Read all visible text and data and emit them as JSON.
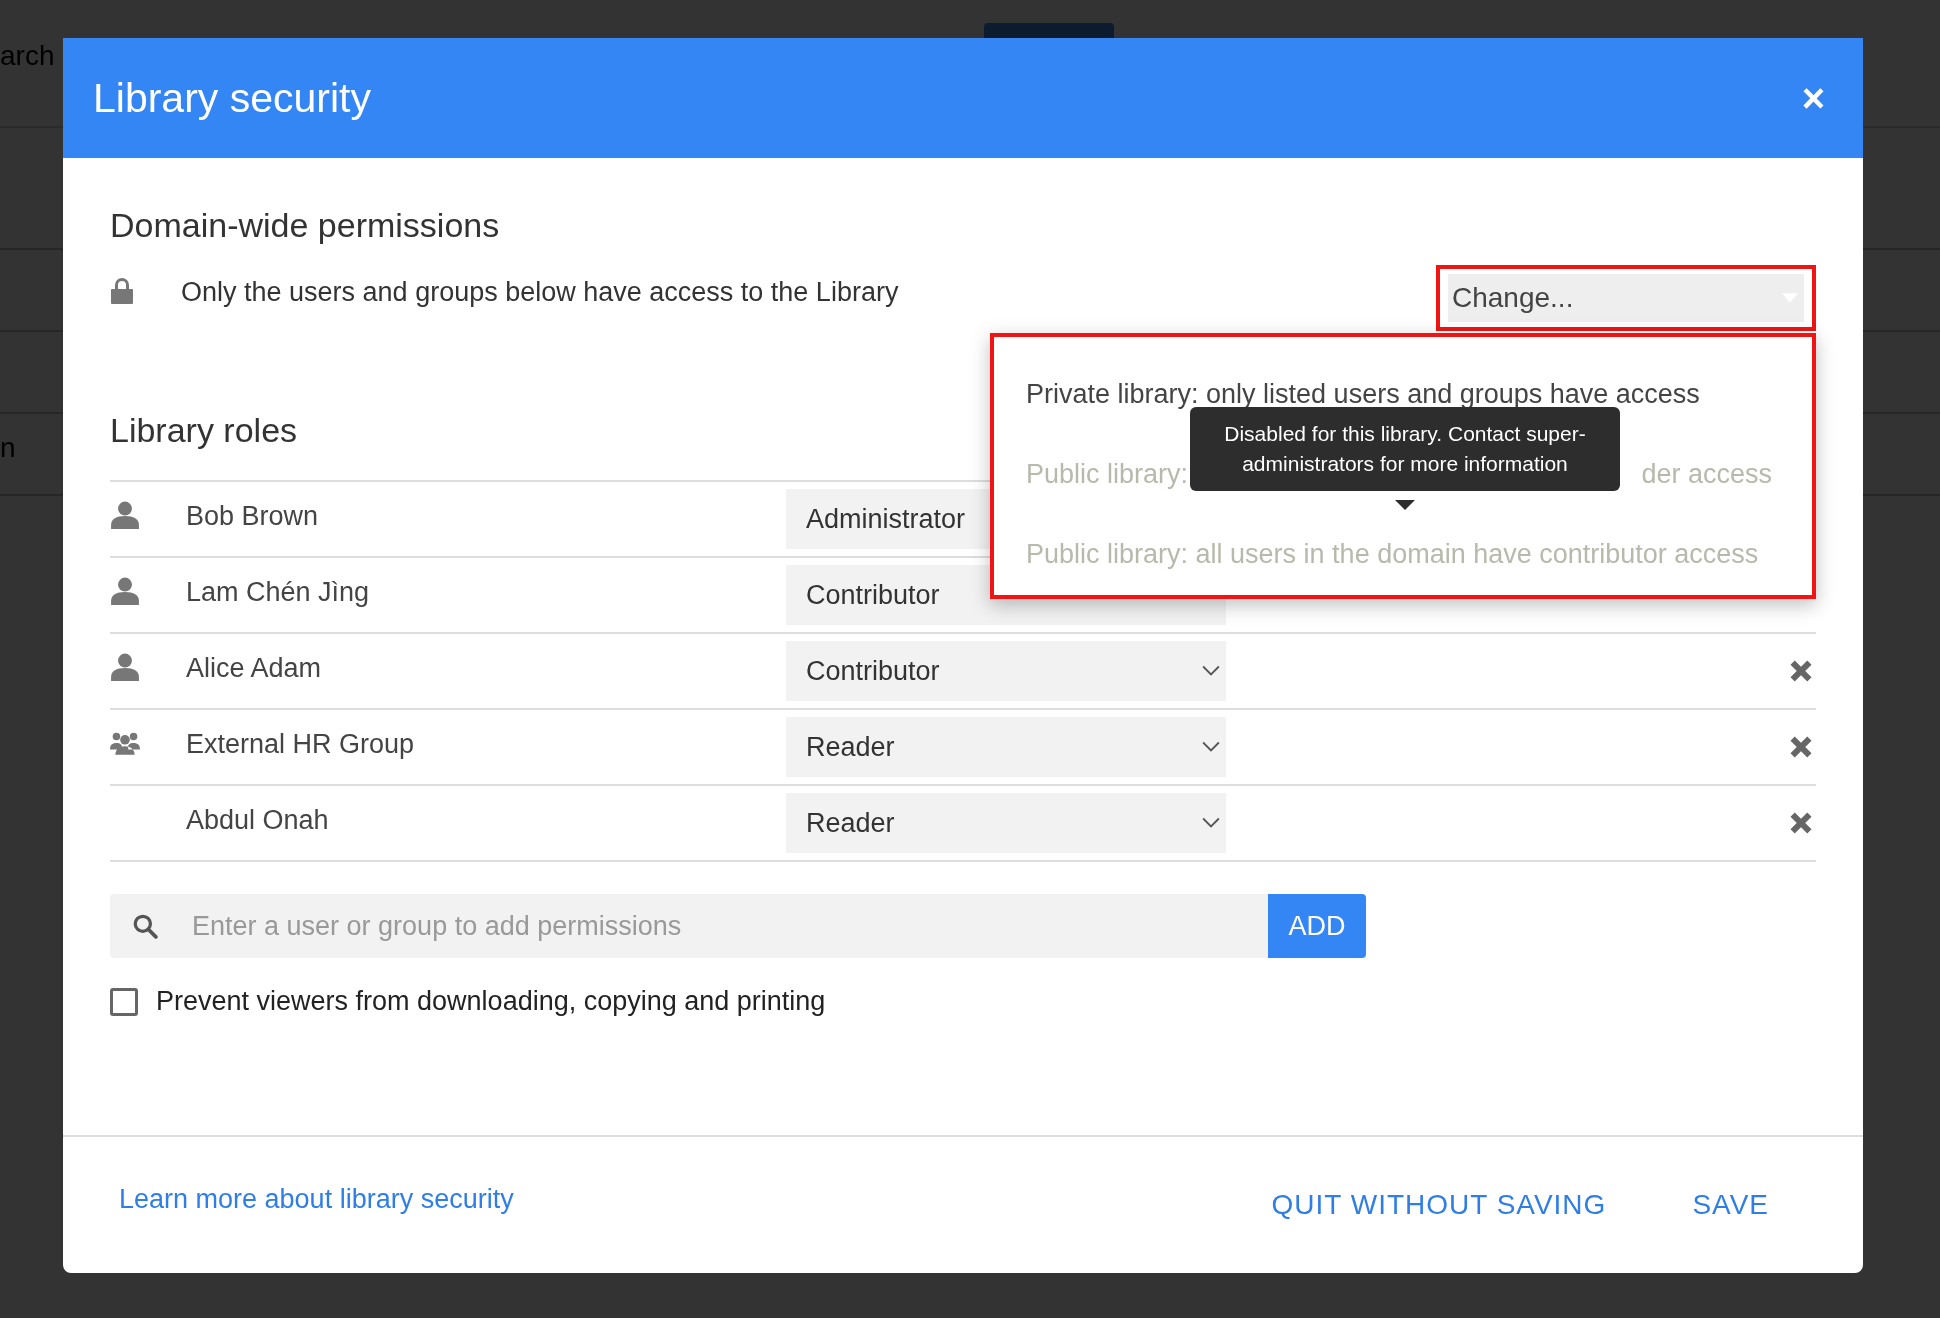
{
  "background": {
    "search_fragment": "arch",
    "side_fragment": "n"
  },
  "dialog": {
    "title": "Library security",
    "close": "×"
  },
  "domain_permissions": {
    "heading": "Domain-wide permissions",
    "description": "Only the users and groups below have access to the Library",
    "change_select": {
      "value": "Change...",
      "expanded": true
    },
    "options": [
      {
        "segments": [
          "Private library: only listed users and groups have access"
        ],
        "disabled": false
      },
      {
        "segments": [
          "Public library:",
          "der access"
        ],
        "disabled": true
      },
      {
        "segments": [
          "Public library: all users in the domain have contributor access"
        ],
        "disabled": true
      }
    ],
    "tooltip": "Disabled for this library. Contact super-administrators for more information"
  },
  "roles": {
    "heading": "Library roles",
    "rows": [
      {
        "kind": "user",
        "name": "Bob Brown",
        "role": "Administrator"
      },
      {
        "kind": "user",
        "name": "Lam Chén Jìng",
        "role": "Contributor"
      },
      {
        "kind": "user",
        "name": "Alice Adam",
        "role": "Contributor"
      },
      {
        "kind": "group",
        "name": "External HR Group",
        "role": "Reader"
      },
      {
        "kind": "none",
        "name": "Abdul Onah",
        "role": "Reader"
      }
    ]
  },
  "add": {
    "placeholder": "Enter a user or group to add permissions",
    "button": "ADD"
  },
  "prevent": {
    "label": "Prevent viewers from downloading, copying and printing",
    "checked": false
  },
  "footer": {
    "link": "Learn more about library security",
    "buttons": [
      "QUIT WITHOUT SAVING",
      "SAVE"
    ]
  }
}
